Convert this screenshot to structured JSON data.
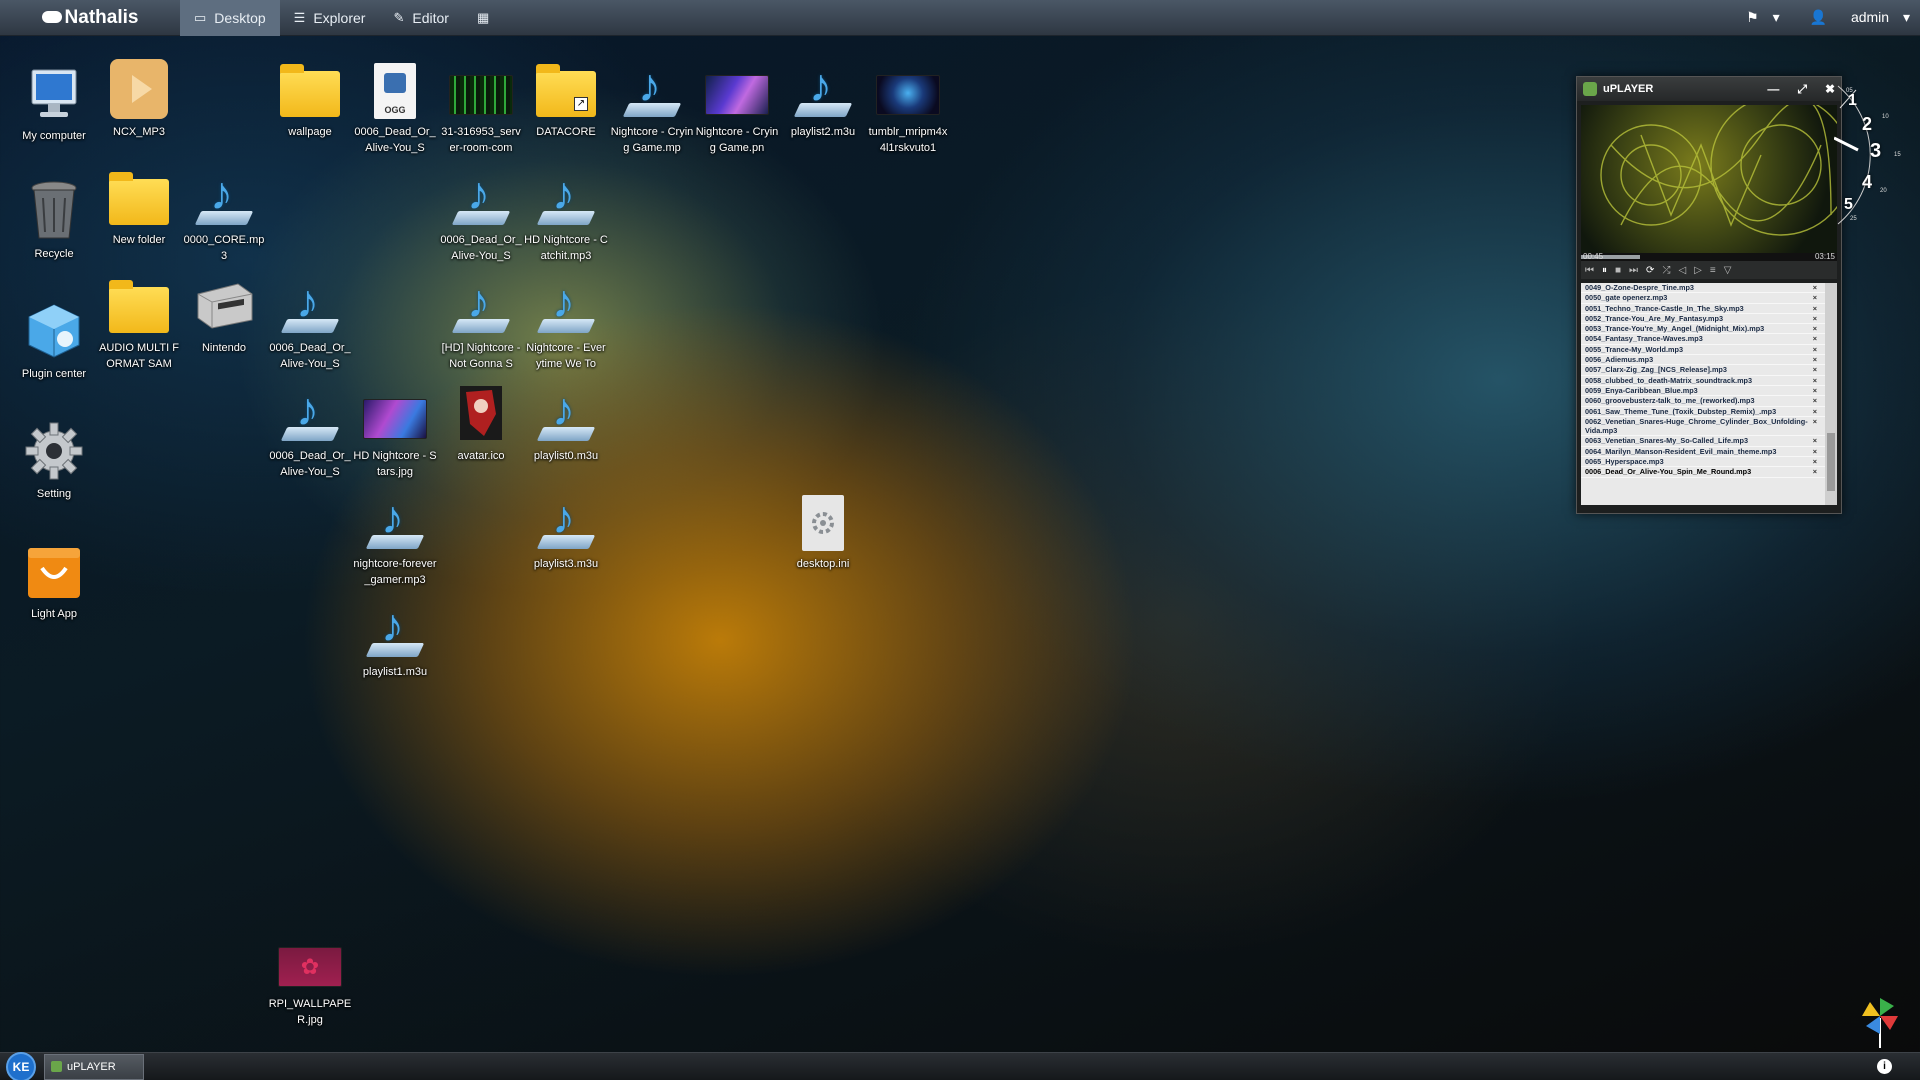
{
  "topbar": {
    "brand": "Nathalis",
    "tabs": [
      {
        "label": "Desktop",
        "icon": "monitor-icon"
      },
      {
        "label": "Explorer",
        "icon": "list-icon"
      },
      {
        "label": "Editor",
        "icon": "edit-icon"
      },
      {
        "label": "",
        "icon": "grid-icon"
      }
    ],
    "user": "admin"
  },
  "desktop_icons": {
    "my_computer": "My computer",
    "recycle": "Recycle",
    "plugin_center": "Plugin center",
    "setting": "Setting",
    "light_app": "Light App",
    "ncx_mp3": "NCX_MP3",
    "new_folder": "New folder",
    "audio_multi": "AUDIO MULTI FORMAT SAM",
    "core_mp3": "0000_CORE.mp3",
    "nintendo": "Nintendo",
    "wallpage": "wallpage",
    "dead_1": "0006_Dead_Or_Alive-You_S",
    "dead_2": "0006_Dead_Or_Alive-You_S",
    "dead_3": "0006_Dead_Or_Alive-You_S",
    "ogg_file": "0006_Dead_Or_Alive-You_S",
    "ogg_tag": "OGG",
    "hd_stars": "HD Nightcore - Stars.jpg",
    "nightcore_gamer": "nightcore-forever_gamer.mp3",
    "playlist1": "playlist1.m3u",
    "server_room": "31-316953_server-room-com",
    "dead_4": "0006_Dead_Or_Alive-You_S",
    "not_gonna": "[HD] Nightcore - Not Gonna S",
    "avatar": "avatar.ico",
    "datacore": "DATACORE",
    "catchit": "HD Nightcore - Catchit.mp3",
    "everytime": "Nightcore - Everytime We To",
    "playlist0": "playlist0.m3u",
    "playlist3": "playlist3.m3u",
    "crying_mp": "Nightcore - Crying Game.mp",
    "crying_pn": "Nightcore - Crying Game.pn",
    "playlist2": "playlist2.m3u",
    "tumblr": "tumblr_mripm4x4l1rskvuto1",
    "desktop_ini": "desktop.ini",
    "rpi": "RPI_WALLPAPER.jpg"
  },
  "uplayer": {
    "title": "uPLAYER",
    "time_current": "00:45",
    "time_total": "03:15",
    "progress": 0.23,
    "playlist": [
      "0049_O-Zone-Despre_Tine.mp3",
      "0050_gate openerz.mp3",
      "0051_Techno_Trance-Castle_In_The_Sky.mp3",
      "0052_Trance-You_Are_My_Fantasy.mp3",
      "0053_Trance-You're_My_Angel_(Midnight_Mix).mp3",
      "0054_Fantasy_Trance-Waves.mp3",
      "0055_Trance-My_World.mp3",
      "0056_Adiemus.mp3",
      "0057_Clarx-Zig_Zag_[NCS_Release].mp3",
      "0058_clubbed_to_death-Matrix_soundtrack.mp3",
      "0059_Enya-Caribbean_Blue.mp3",
      "0060_groovebusterz-talk_to_me_(reworked).mp3",
      "0061_Saw_Theme_Tune_(Toxik_Dubstep_Remix)_.mp3",
      "0062_Venetian_Snares-Huge_Chrome_Cylinder_Box_Unfolding-Vida.mp3",
      "0063_Venetian_Snares-My_So-Called_Life.mp3",
      "0064_Marilyn_Manson-Resident_Evil_main_theme.mp3",
      "0065_Hyperspace.mp3",
      "0006_Dead_Or_Alive-You_Spin_Me_Round.mp3"
    ],
    "remove_glyph": "×"
  },
  "clock": {
    "numbers": [
      "1",
      "2",
      "3",
      "4",
      "5"
    ],
    "ticks": [
      "05",
      "10",
      "15",
      "20",
      "25"
    ]
  },
  "taskbar": {
    "start_label": "KE",
    "task": "uPLAYER",
    "info": "i"
  }
}
